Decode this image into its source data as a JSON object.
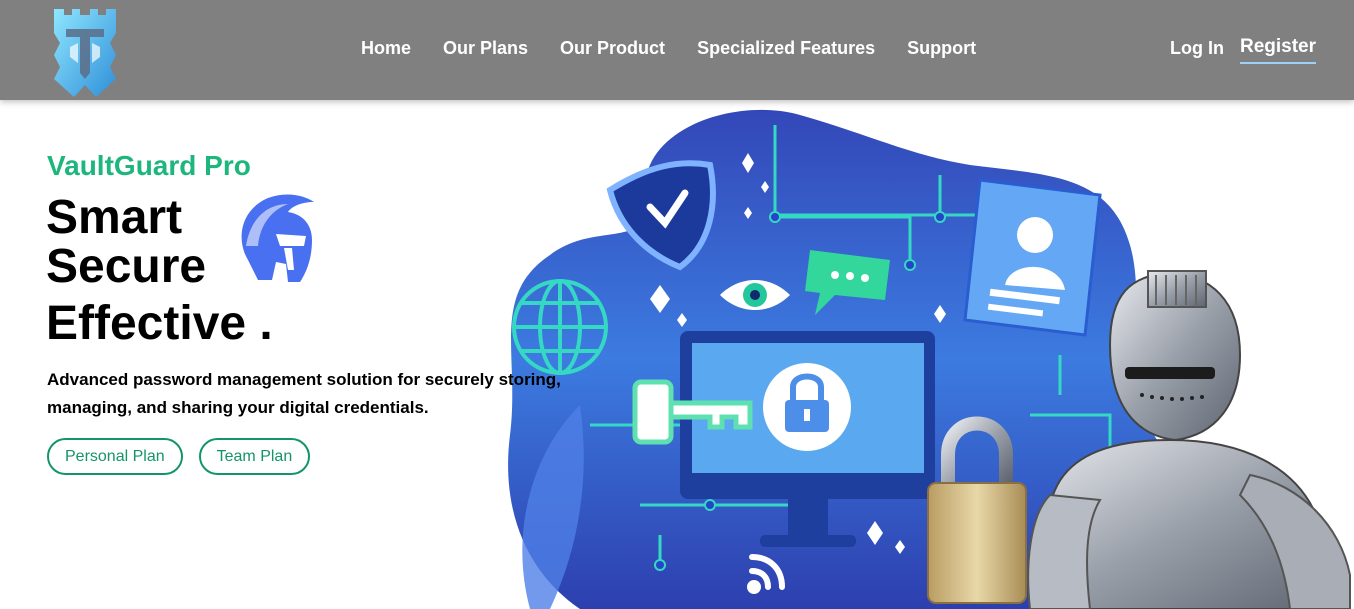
{
  "nav": {
    "logo_icon": "castle-helmet-logo-icon",
    "links": [
      "Home",
      "Our Plans",
      "Our Product",
      "Specialized Features",
      "Support"
    ],
    "login": "Log In",
    "register": "Register"
  },
  "hero": {
    "brand": "VaultGuard Pro",
    "line1": "Smart",
    "line2": "Secure",
    "line3": "Effective .",
    "description": "Advanced password management solution for securely storing, managing, and sharing your digital credentials.",
    "buttons": [
      "Personal Plan",
      "Team Plan"
    ],
    "helmet_icon": "spartan-helmet-icon"
  },
  "colors": {
    "nav_bg": "#808080",
    "brand_green": "#1db67c",
    "button_green": "#14946a",
    "blob_blue": "#3d5bd6",
    "register_underline": "#9fd0f5"
  },
  "illustration": {
    "icons": [
      "shield-check-icon",
      "eye-icon",
      "chat-bubble-icon",
      "user-card-icon",
      "globe-icon",
      "monitor-lock-icon",
      "key-icon",
      "wifi-icon",
      "padlock-icon",
      "knight-armor-icon"
    ]
  }
}
